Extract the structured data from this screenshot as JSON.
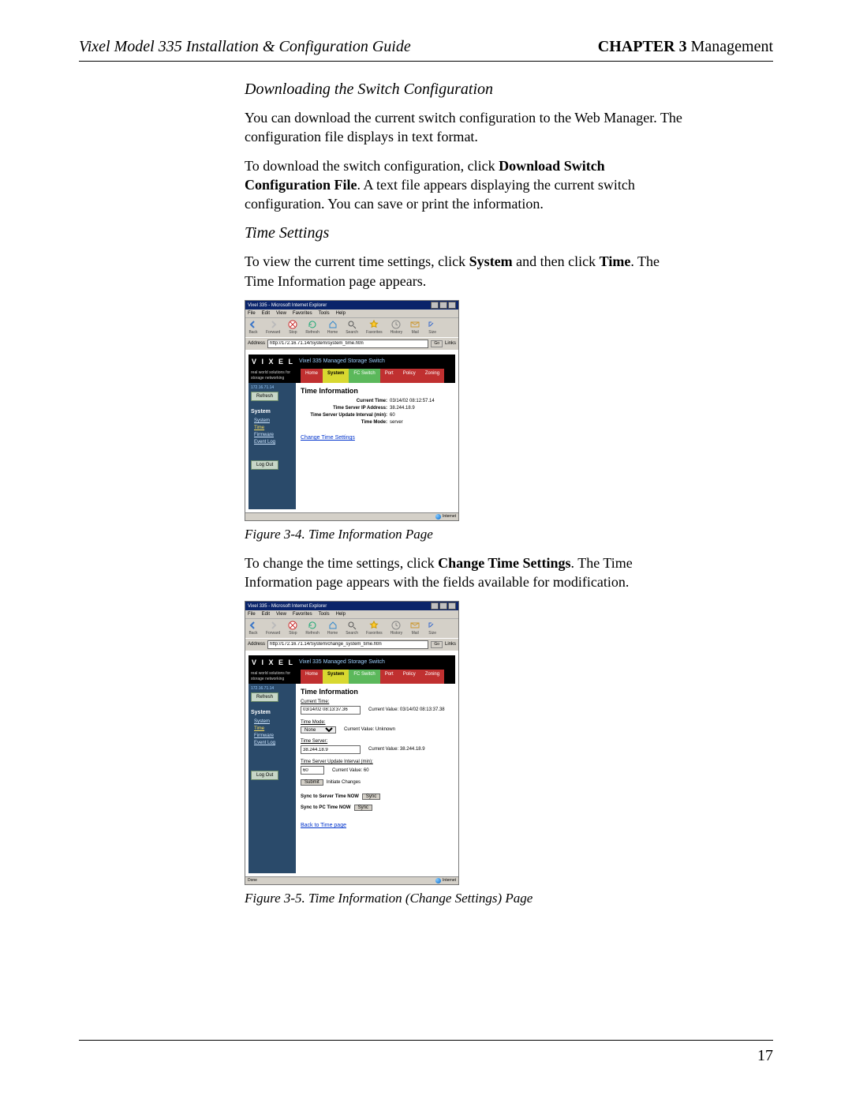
{
  "header": {
    "left": "Vixel Model 335 Installation & Configuration Guide",
    "chapter": "CHAPTER 3",
    "section": "Management"
  },
  "body": {
    "h1": "Downloading the Switch Configuration",
    "p1": "You can download the current switch configuration to the Web Manager. The configuration file displays in text format.",
    "p2a": "To download the switch configuration, click ",
    "p2b": "Download Switch Configuration File",
    "p2c": ". A text file appears displaying the current switch configuration. You can save or print the information.",
    "h2": "Time Settings",
    "p3a": "To view the current time settings, click ",
    "p3b": "System",
    "p3c": " and then click ",
    "p3d": "Time",
    "p3e": ". The Time Information page appears.",
    "cap1": "Figure 3-4. Time Information Page",
    "p4a": "To change the time settings, click ",
    "p4b": "Change Time Settings",
    "p4c": ". The Time Information page appears with the fields available for modification.",
    "cap2": "Figure 3-5. Time Information (Change Settings) Page"
  },
  "pageno": "17",
  "ie": {
    "title": "Vixel 335 - Microsoft Internet Explorer",
    "menus": [
      "File",
      "Edit",
      "View",
      "Favorites",
      "Tools",
      "Help"
    ],
    "toolbar": [
      "Back",
      "Forward",
      "Stop",
      "Refresh",
      "Home",
      "Search",
      "Favorites",
      "History",
      "Mail",
      "Size"
    ],
    "addr_label": "Address",
    "go": "Go",
    "links": "Links",
    "status_zone": "Internet",
    "status_done": "Done"
  },
  "shot1": {
    "url": "http://172.16.71.14/System/system_time.htm",
    "banner_sub": "Vixel 335 Managed Storage Switch",
    "side_tag": "real world solutions\nfor storage networking",
    "tabs": [
      "Home",
      "System",
      "FC Switch",
      "Port",
      "Policy",
      "Zoning"
    ],
    "ip": "172.16.71.14",
    "refresh": "Refresh",
    "nav_group": "System",
    "nav_items": [
      "System",
      "Time",
      "Firmware",
      "Event Log"
    ],
    "logout": "Log Out",
    "main_title": "Time Information",
    "kv": [
      {
        "k": "Current Time:",
        "v": "03/14/02 08:12:57.14"
      },
      {
        "k": "Time Server IP Address:",
        "v": "38.244.18.9"
      },
      {
        "k": "Time Server Update Interval (min):",
        "v": "60"
      },
      {
        "k": "Time Mode:",
        "v": "server"
      }
    ],
    "change_link": "Change Time Settings"
  },
  "shot2": {
    "url": "http://172.16.71.14/System/change_system_time.htm",
    "main_title": "Time Information",
    "f_currtime": {
      "label": "Current Time:",
      "value": "03/14/02 08:13:37.36",
      "curlbl": "Current Value:",
      "cur": "03/14/02 08:13:37.38"
    },
    "f_mode": {
      "label": "Time Mode:",
      "value": "None",
      "curlbl": "Current Value:",
      "cur": "Unknown"
    },
    "f_server": {
      "label": "Time Server:",
      "value": "38.244.18.9",
      "curlbl": "Current Value:",
      "cur": "38.244.18.9"
    },
    "f_interval": {
      "label": "Time Server Update Interval (min):",
      "value": "60",
      "curlbl": "Current Value:",
      "cur": "60"
    },
    "submit": "Submit",
    "submit_tail": "Initiate Changes",
    "sync_server_lbl": "Sync to Server Time NOW",
    "sync_server_btn": "Sync",
    "sync_pc_lbl": "Sync to PC Time NOW",
    "sync_pc_btn": "Sync",
    "back_link": "Back to Time page"
  }
}
